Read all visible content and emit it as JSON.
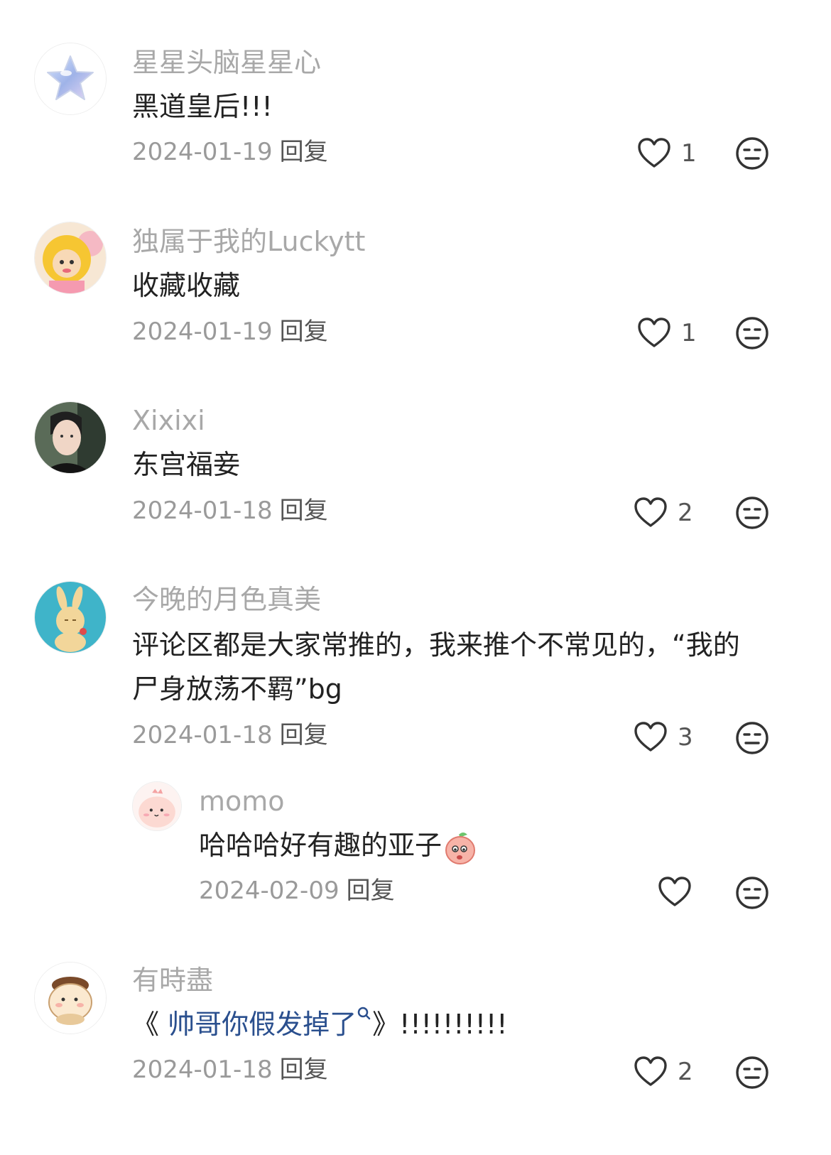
{
  "comments": [
    {
      "username": "星星头脑星星心",
      "text": "黑道皇后!!!",
      "date": "2024-01-19",
      "reply_label": "回复",
      "likes": "1",
      "avatar_icon": "star-avatar"
    },
    {
      "username": "独属于我的Luckytt",
      "text": "收藏收藏",
      "date": "2024-01-19",
      "reply_label": "回复",
      "likes": "1",
      "avatar_icon": "cartoon-girl-avatar"
    },
    {
      "username": "Xixixi",
      "text": "东宫福妾",
      "date": "2024-01-18",
      "reply_label": "回复",
      "likes": "2",
      "avatar_icon": "person-photo-avatar"
    },
    {
      "username": "今晚的月色真美",
      "text_line1": "评论区都是大家常推的，我来推个不常见的，“我的",
      "text_line2": "尸身放荡不羁”bg",
      "date": "2024-01-18",
      "reply_label": "回复",
      "likes": "3",
      "avatar_icon": "rabbit-avatar",
      "reply": {
        "username": "momo",
        "text": "哈哈哈好有趣的亚子",
        "date": "2024-02-09",
        "reply_label": "回复",
        "avatar_icon": "pink-blob-avatar",
        "emoji": "peach-emoji"
      }
    },
    {
      "username": "有時盡",
      "text_prefix": "《",
      "text_link": " 帅哥你假发掉了",
      "text_link_icon": "search-icon",
      "text_suffix": "》!!!!!!!!!!",
      "date": "2024-01-18",
      "reply_label": "回复",
      "likes": "2",
      "avatar_icon": "cartoon-bun-avatar"
    }
  ],
  "colors": {
    "username": "#a8a8a8",
    "text": "#222222",
    "meta": "#9a9a9a",
    "link": "#2a4f8e"
  }
}
